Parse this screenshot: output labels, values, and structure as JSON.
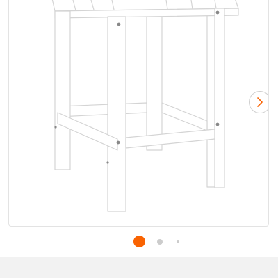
{
  "gallery": {
    "product_image_icon": "adirondack-side-table-image",
    "next_icon": "chevron-right-icon",
    "pagination": {
      "total": 3,
      "active_index": 0,
      "active_color": "#f96302",
      "inactive_color": "#cccccc"
    }
  },
  "colors": {
    "table": "#ffffff",
    "table_outline": "#d4d4d4",
    "band": "#f2f2f2"
  }
}
